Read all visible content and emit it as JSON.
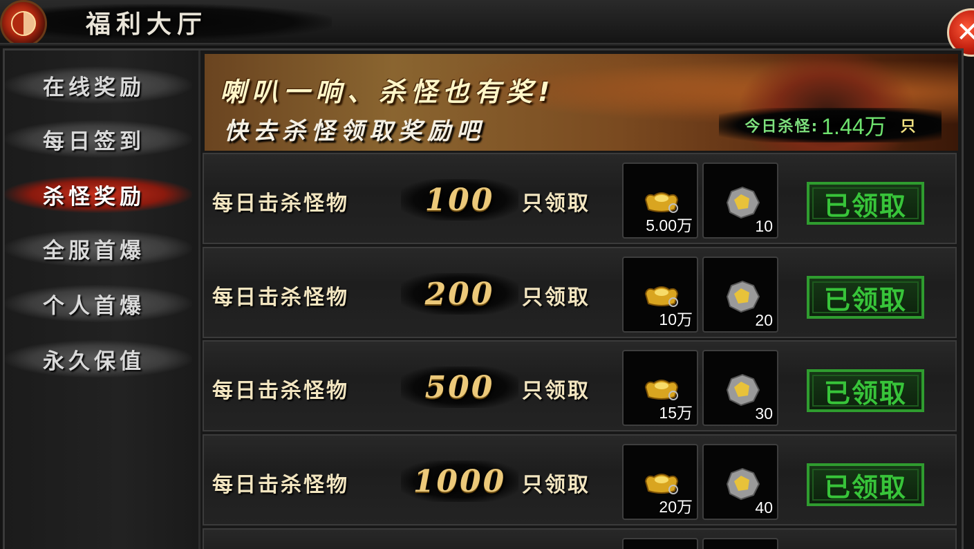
{
  "header": {
    "title": "福利大厅",
    "close_icon": "close-icon"
  },
  "sidebar": {
    "items": [
      {
        "label": "在线奖励",
        "active": false
      },
      {
        "label": "每日签到",
        "active": false
      },
      {
        "label": "杀怪奖励",
        "active": true
      },
      {
        "label": "全服首爆",
        "active": false
      },
      {
        "label": "个人首爆",
        "active": false
      },
      {
        "label": "永久保值",
        "active": false
      }
    ]
  },
  "banner": {
    "line1": "喇叭一响、杀怪也有奖!",
    "line2": "快去杀怪领取奖励吧",
    "kills_label": "今日杀怪:",
    "kills_value": "1.44万",
    "kills_unit": "只"
  },
  "rows": [
    {
      "label": "每日击杀怪物",
      "count": "100",
      "suffix": "只领取",
      "gold_qty": "5.00万",
      "ore_qty": "10",
      "button": "已领取"
    },
    {
      "label": "每日击杀怪物",
      "count": "200",
      "suffix": "只领取",
      "gold_qty": "10万",
      "ore_qty": "20",
      "button": "已领取"
    },
    {
      "label": "每日击杀怪物",
      "count": "500",
      "suffix": "只领取",
      "gold_qty": "15万",
      "ore_qty": "30",
      "button": "已领取"
    },
    {
      "label": "每日击杀怪物",
      "count": "1000",
      "suffix": "只领取",
      "gold_qty": "20万",
      "ore_qty": "40",
      "button": "已领取"
    }
  ],
  "colors": {
    "accent_red": "#c8301c",
    "claimed_green": "#38c43a",
    "kill_count_green": "#6fe36f",
    "count_gold": "#ecc97a"
  }
}
